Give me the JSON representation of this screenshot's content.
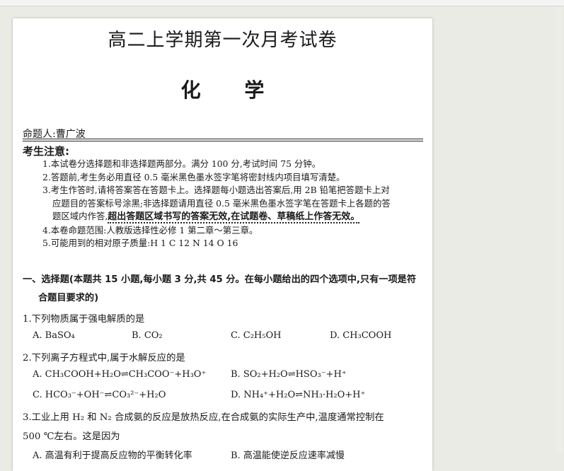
{
  "exam": {
    "title": "高二上学期第一次月考试卷",
    "subject_chars": [
      "化",
      "学"
    ],
    "author": "命题人:曹广波",
    "notice_heading": "考生注意:",
    "notes": [
      "1.本试卷分选择题和非选择题两部分。满分 100 分,考试时间 75 分钟。",
      "2.答题前,考生务必用直径 0.5 毫米黑色墨水签字笔将密封线内项目填写清楚。",
      "3.考生作答时,请将答案答在答题卡上。选择题每小题选出答案后,用 2B 铅笔把答题卡上对",
      "应题目的答案标号涂黑;非选择题请用直径 0.5 毫米黑色墨水签字笔在答题卡上各题的答",
      "题区域内作答,",
      "超出答题区域书写的答案无效,在试题卷、草稿纸上作答无效。",
      "4.本卷命题范围:人教版选择性必修 1 第二章～第三章。",
      "5.可能用到的相对原子质量:H 1   C 12   N 14   O 16"
    ],
    "section_heading_1": "一、选择题(本题共 15 小题,每小题 3 分,共 45 分。在每小题给出的四个选项中,只有一项是符",
    "section_heading_2": "合题目要求的)",
    "q1": {
      "stem": "1.下列物质属于强电解质的是",
      "a": "A. BaSO₄",
      "b": "B. CO₂",
      "c": "C. C₂H₅OH",
      "d": "D. CH₃COOH"
    },
    "q2": {
      "stem": "2.下列离子方程式中,属于水解反应的是",
      "a": "A. CH₃COOH+H₂O⇌CH₃COO⁻+H₃O⁺",
      "b": "B. SO₂+H₂O⇌HSO₃⁻+H⁺",
      "c": "C. HCO₃⁻+OH⁻⇌CO₃²⁻+H₂O",
      "d": "D. NH₄⁺+H₂O⇌NH₃·H₂O+H⁺"
    },
    "q3": {
      "stem_1": "3.工业上用 H₂ 和 N₂ 合成氨的反应是放热反应,在合成氨的实际生产中,温度通常控制在",
      "stem_2": "500 ℃左右。这是因为",
      "a": "A. 高温有利于提高反应物的平衡转化率",
      "b": "B. 高温能使逆反应速率减慢"
    }
  }
}
